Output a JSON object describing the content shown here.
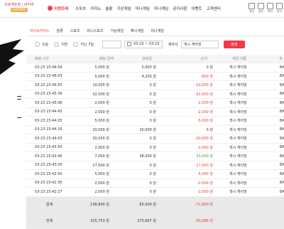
{
  "topnav": {
    "logo_line1": "프로젝트명 | 바카라",
    "logo_line2": "CASINO",
    "event_badge": "이벤트배",
    "menu": [
      "스포츠",
      "카지노",
      "슬롯",
      "가상게임",
      "미니게임",
      "미니게임",
      "공지사항",
      "이벤트",
      "고객센터"
    ],
    "right_icons": [
      "충전",
      "환전",
      "쪽지",
      "마이"
    ]
  },
  "tabs": [
    "라이브카지노",
    "슬롯",
    "스포츠",
    "미니스포츠",
    "가상게임",
    "해시게임",
    "미니게임"
  ],
  "filters": {
    "today": "오늘",
    "week": "이번",
    "last7": "지난 7일",
    "select_value": "",
    "date_range": "03-23 ~ 03-23",
    "provider_label": "제조사",
    "provider_value": "섹시 게이밍",
    "search_button": "검색"
  },
  "table": {
    "headers": [
      "배팅 시간",
      "배팅 금액",
      "당첨금",
      "손익",
      "게임 이름",
      "B"
    ],
    "rows": [
      {
        "time": "03-23 23:46:54",
        "bet": "5,000 원",
        "win": "5,000 원",
        "pl": "0 원",
        "plc": "neu",
        "game": "섹시 게이밍",
        "x": "BA"
      },
      {
        "time": "03-23 23:46:03",
        "bet": "5,000 원",
        "win": "4,200 원",
        "pl": "-800 원",
        "plc": "neg",
        "game": "섹시 게이밍",
        "x": "BA"
      },
      {
        "time": "03-23 23:45:55",
        "bet": "10,000 원",
        "win": "0 원",
        "pl": "-10,000 원",
        "plc": "neg",
        "game": "섹시 게이밍",
        "x": "BA"
      },
      {
        "time": "03-23 23:45:39",
        "bet": "32,000 원",
        "win": "0 원",
        "pl": "-32,000 원",
        "plc": "neg",
        "game": "섹시 게이밍",
        "x": "BA"
      },
      {
        "time": "03-23 23:45:06",
        "bet": "2,000 원",
        "win": "0 원",
        "pl": "-2,000 원",
        "plc": "neg",
        "game": "섹시 게이밍",
        "x": "BA"
      },
      {
        "time": "03-23 23:44:43",
        "bet": "2,000 원",
        "win": "0 원",
        "pl": "-2,000 원",
        "plc": "neg",
        "game": "섹시 게이밍",
        "x": "BA"
      },
      {
        "time": "03-23 23:44:25",
        "bet": "5,000 원",
        "win": "0 원",
        "pl": "-5,000 원",
        "plc": "neg",
        "game": "섹시 게이밍",
        "x": "BA"
      },
      {
        "time": "03-23 23:44:16",
        "bet": "20,000 원",
        "win": "20,000 원",
        "pl": "0 원",
        "plc": "neu",
        "game": "섹시 게이밍",
        "x": "BA"
      },
      {
        "time": "03-23 23:44:03",
        "bet": "20,000 원",
        "win": "0 원",
        "pl": "-20,000 원",
        "plc": "neg",
        "game": "섹시 게이밍",
        "x": "BA"
      },
      {
        "time": "03-23 23:43:50",
        "bet": "2,000 원",
        "win": "0 원",
        "pl": "-2,000 원",
        "plc": "neg",
        "game": "섹시 게이밍",
        "x": "BA"
      },
      {
        "time": "03-23 23:43:40",
        "bet": "7,000 원",
        "win": "38,000 원",
        "pl": "31,000 원",
        "plc": "pos",
        "game": "섹시 게이밍",
        "x": "BA"
      },
      {
        "time": "03-23 23:43:05",
        "bet": "17,000 원",
        "win": "0 원",
        "pl": "-17,000 원",
        "plc": "neg",
        "game": "섹시 게이밍",
        "x": "BA"
      },
      {
        "time": "03-23 23:42:50",
        "bet": "5,000 원",
        "win": "0 원",
        "pl": "-5,000 원",
        "plc": "neg",
        "game": "섹시 게이밍",
        "x": "BA"
      },
      {
        "time": "03-23 23:42:30",
        "bet": "2,000 원",
        "win": "0 원",
        "pl": "-2,000 원",
        "plc": "neg",
        "game": "섹시 게이밍",
        "x": "BA"
      },
      {
        "time": "03-23 23:42:27",
        "bet": "2,000 원",
        "win": "0 원",
        "pl": "-2,000 원",
        "plc": "neg",
        "game": "섹시 게이밍",
        "x": "BA"
      }
    ],
    "sum": {
      "label": "합계",
      "bet": "136,800 원",
      "win": "65,000 원",
      "pl": "-71,800 원"
    },
    "total": {
      "label": "전체",
      "bet": "325,753 원",
      "win": "275,667 원",
      "pl": "-50,086 원"
    }
  },
  "colors": {
    "accent": "#ef3b4a",
    "negative": "#e53935",
    "positive": "#2e9e40"
  }
}
